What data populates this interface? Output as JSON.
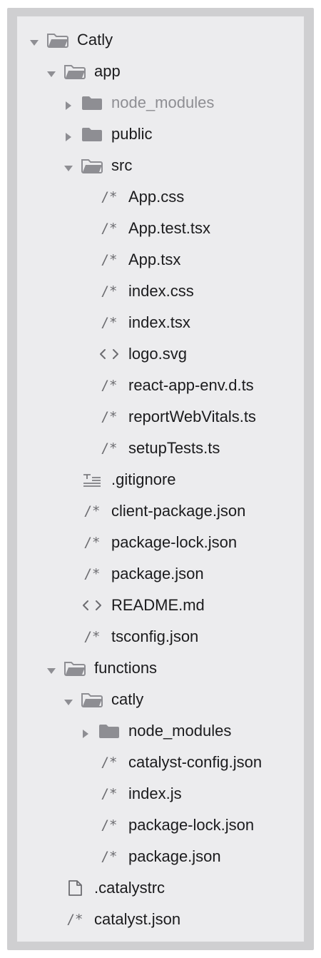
{
  "colors": {
    "panel": "#ececee",
    "frame": "#cfcfd1",
    "folder": "#8e8e93",
    "text": "#1b1b1d",
    "dimmed_text": "#8e8e93",
    "icon": "#6c6c70"
  },
  "tree": [
    {
      "label": "Catly",
      "depth": 0,
      "kind": "folder",
      "expanded": true
    },
    {
      "label": "app",
      "depth": 1,
      "kind": "folder",
      "expanded": true
    },
    {
      "label": "node_modules",
      "depth": 2,
      "kind": "folder",
      "expanded": false,
      "dimmed": true
    },
    {
      "label": "public",
      "depth": 2,
      "kind": "folder",
      "expanded": false
    },
    {
      "label": "src",
      "depth": 2,
      "kind": "folder",
      "expanded": true
    },
    {
      "label": "App.css",
      "depth": 3,
      "kind": "file",
      "icon": "code-comment-icon"
    },
    {
      "label": "App.test.tsx",
      "depth": 3,
      "kind": "file",
      "icon": "code-comment-icon"
    },
    {
      "label": "App.tsx",
      "depth": 3,
      "kind": "file",
      "icon": "code-comment-icon"
    },
    {
      "label": "index.css",
      "depth": 3,
      "kind": "file",
      "icon": "code-comment-icon"
    },
    {
      "label": "index.tsx",
      "depth": 3,
      "kind": "file",
      "icon": "code-comment-icon"
    },
    {
      "label": "logo.svg",
      "depth": 3,
      "kind": "file",
      "icon": "angle-brackets-icon"
    },
    {
      "label": "react-app-env.d.ts",
      "depth": 3,
      "kind": "file",
      "icon": "code-comment-icon"
    },
    {
      "label": "reportWebVitals.ts",
      "depth": 3,
      "kind": "file",
      "icon": "code-comment-icon"
    },
    {
      "label": "setupTests.ts",
      "depth": 3,
      "kind": "file",
      "icon": "code-comment-icon"
    },
    {
      "label": ".gitignore",
      "depth": 2,
      "kind": "file",
      "icon": "text-lines-icon"
    },
    {
      "label": "client-package.json",
      "depth": 2,
      "kind": "file",
      "icon": "code-comment-icon"
    },
    {
      "label": "package-lock.json",
      "depth": 2,
      "kind": "file",
      "icon": "code-comment-icon"
    },
    {
      "label": "package.json",
      "depth": 2,
      "kind": "file",
      "icon": "code-comment-icon"
    },
    {
      "label": "README.md",
      "depth": 2,
      "kind": "file",
      "icon": "angle-brackets-icon"
    },
    {
      "label": "tsconfig.json",
      "depth": 2,
      "kind": "file",
      "icon": "code-comment-icon"
    },
    {
      "label": "functions",
      "depth": 1,
      "kind": "folder",
      "expanded": true
    },
    {
      "label": "catly",
      "depth": 2,
      "kind": "folder",
      "expanded": true
    },
    {
      "label": "node_modules",
      "depth": 3,
      "kind": "folder",
      "expanded": false
    },
    {
      "label": "catalyst-config.json",
      "depth": 3,
      "kind": "file",
      "icon": "code-comment-icon"
    },
    {
      "label": "index.js",
      "depth": 3,
      "kind": "file",
      "icon": "code-comment-icon"
    },
    {
      "label": "package-lock.json",
      "depth": 3,
      "kind": "file",
      "icon": "code-comment-icon"
    },
    {
      "label": "package.json",
      "depth": 3,
      "kind": "file",
      "icon": "code-comment-icon"
    },
    {
      "label": ".catalystrc",
      "depth": 1,
      "kind": "file",
      "icon": "blank-document-icon"
    },
    {
      "label": "catalyst.json",
      "depth": 1,
      "kind": "file",
      "icon": "code-comment-icon"
    }
  ]
}
